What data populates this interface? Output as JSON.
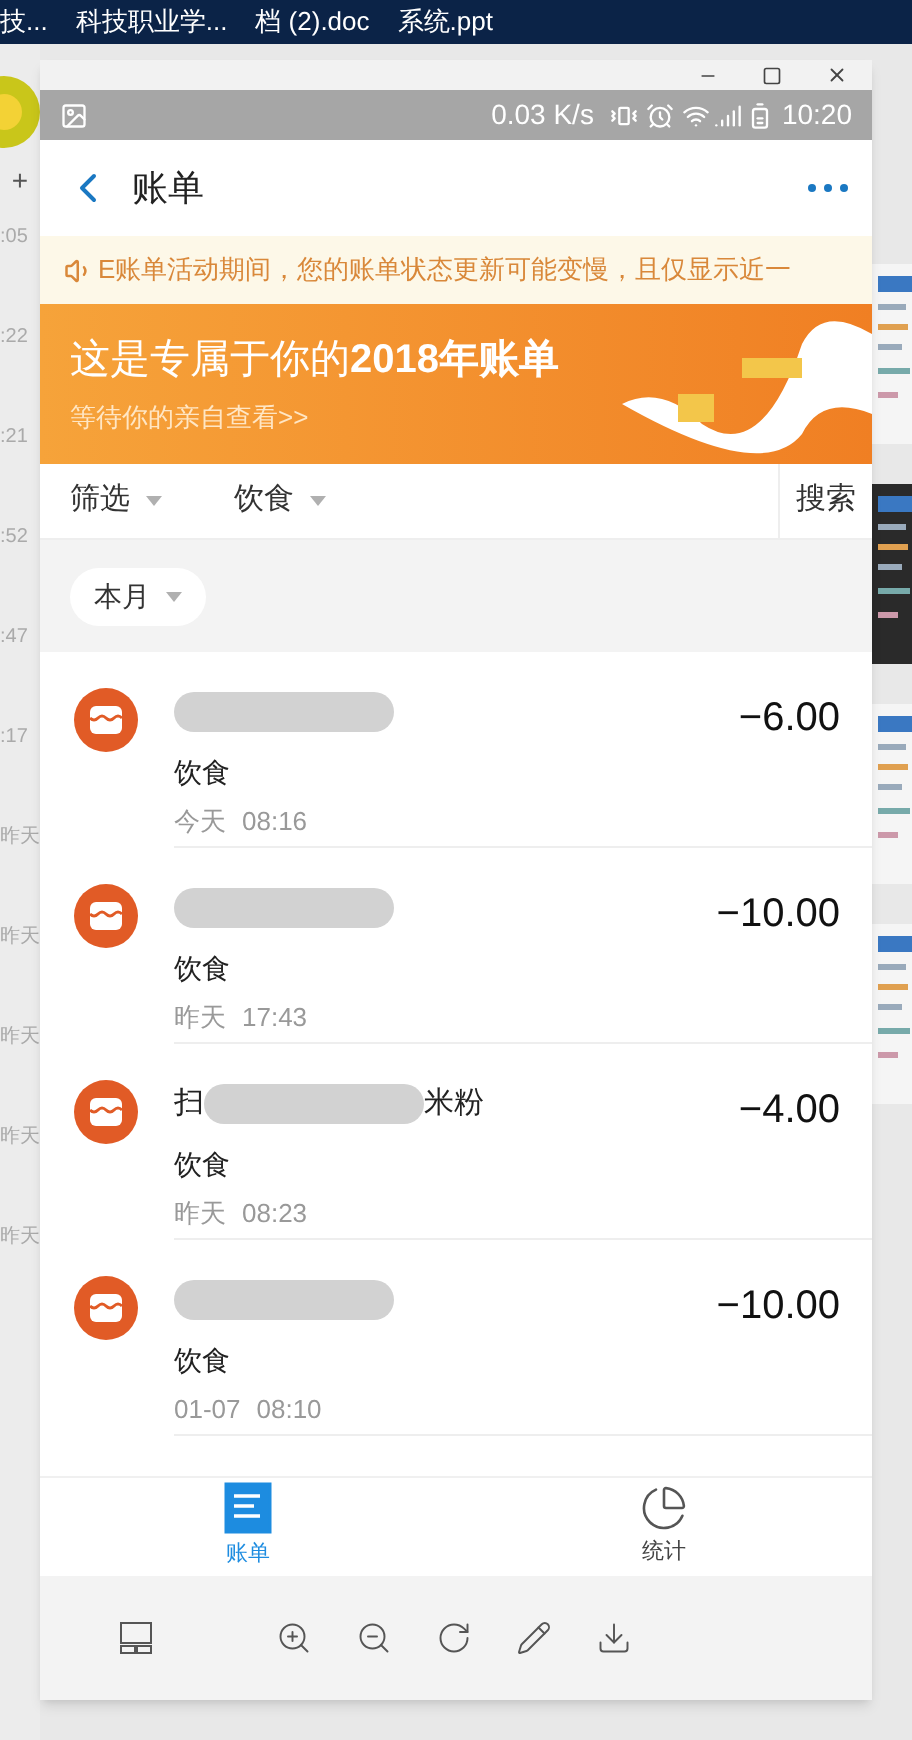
{
  "taskbar": {
    "items": [
      "技...",
      "科技职业学...",
      "档 (2).doc",
      "系统.ppt"
    ]
  },
  "left_strip": {
    "add": "+",
    "times": [
      ":05",
      ":22",
      ":21",
      ":52",
      ":47",
      ":17",
      "昨天",
      "昨天",
      "昨天",
      "昨天",
      "昨天"
    ]
  },
  "status_bar": {
    "speed": "0.03 K/s",
    "time": "10:20"
  },
  "header": {
    "title": "账单"
  },
  "notice": "E账单活动期间，您的账单状态更新可能变慢，且仅显示近一",
  "banner": {
    "title": "这是专属于你的**2018年账单**",
    "subtitle": "等待你的亲自查看>>"
  },
  "filters": [
    {
      "label": "筛选"
    },
    {
      "label": "饮食"
    }
  ],
  "search": "搜索",
  "period": "本月",
  "transactions": [
    {
      "category": "饮食",
      "date": "今天",
      "time": "08:16",
      "amount": "−6.00"
    },
    {
      "category": "饮食",
      "date": "昨天",
      "time": "17:43",
      "amount": "−10.00"
    },
    {
      "name_start": "扫",
      "name_end": "米粉",
      "category": "饮食",
      "date": "昨天",
      "time": "08:23",
      "amount": "−4.00"
    },
    {
      "category": "饮食",
      "date": "01-07",
      "time": "08:10",
      "amount": "−10.00"
    }
  ],
  "tab_bar": [
    {
      "kind": "bill",
      "label": "账单",
      "selected": true
    },
    {
      "kind": "stats",
      "label": "统计",
      "selected": false
    }
  ]
}
